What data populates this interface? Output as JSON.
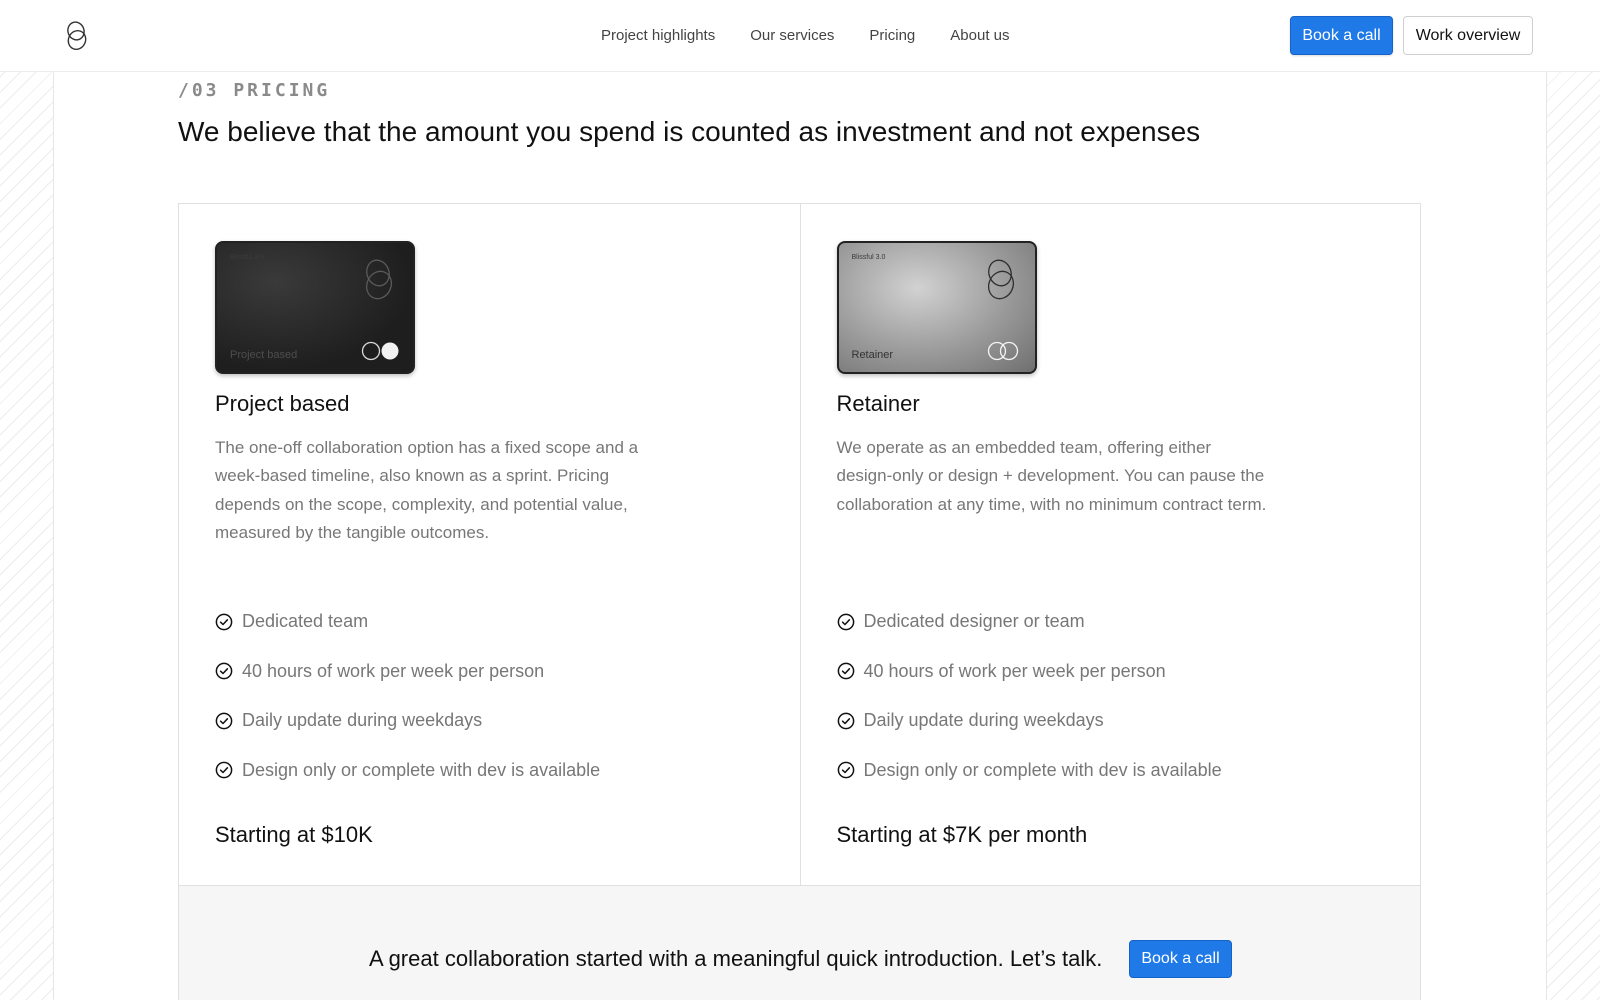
{
  "nav": {
    "links": [
      "Project highlights",
      "Our services",
      "Pricing",
      "About us"
    ],
    "book_call": "Book a call",
    "work_overview": "Work overview"
  },
  "section": {
    "label": "/03 PRICING",
    "title": "We believe that the amount you spend is counted as investment and not expenses"
  },
  "plans": [
    {
      "card_brand": "Blissful 3.0",
      "card_name": "Project based",
      "title": "Project based",
      "description": "The one-off collaboration option has a fixed scope and a week-based timeline, also known as a sprint. Pricing depends on the scope, complexity, and potential value, measured by the tangible outcomes.",
      "features": [
        "Dedicated team",
        "40 hours of work per week per person",
        "Daily update during weekdays",
        "Design only or complete with dev is available"
      ],
      "price": "Starting at $10K"
    },
    {
      "card_brand": "Blissful 3.0",
      "card_name": "Retainer",
      "title": "Retainer",
      "description": "We operate as an embedded team, offering either design-only or design + development. You can pause the collaboration at any time, with no minimum contract term.",
      "features": [
        "Dedicated designer or team",
        "40 hours of work per week per person",
        "Daily update during weekdays",
        "Design only or complete with dev is available"
      ],
      "price": "Starting at $7K per month"
    }
  ],
  "cta": {
    "text": "A great collaboration started with a meaningful quick introduction. Let’s talk.",
    "button": "Book a call"
  },
  "colors": {
    "accent": "#1f7ae8",
    "muted_text": "#777777"
  },
  "icons": {
    "logo": "brand-logo-icon",
    "feature_check": "check-circle-icon",
    "card_circles": "card-circles-icon"
  }
}
